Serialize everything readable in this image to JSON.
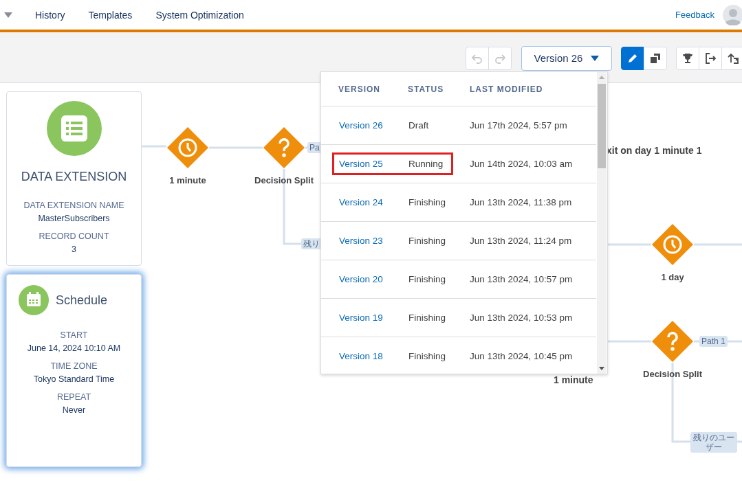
{
  "header": {
    "nav": [
      "History",
      "Templates",
      "System Optimization"
    ],
    "feedback": "Feedback"
  },
  "toolbar": {
    "undo_disabled": true,
    "redo_disabled": true,
    "version_button": "Version 26",
    "mode_buttons": [
      {
        "kind": "edit",
        "selected": true
      },
      {
        "kind": "copy",
        "selected": false
      }
    ],
    "action_buttons": [
      {
        "kind": "trophy"
      },
      {
        "kind": "exit"
      },
      {
        "kind": "swap"
      }
    ]
  },
  "version_menu": {
    "columns": [
      "VERSION",
      "STATUS",
      "LAST MODIFIED"
    ],
    "rows": [
      {
        "version": "Version 26",
        "status": "Draft",
        "last_modified": "Jun 17th 2024, 5:57 pm",
        "highlighted": false
      },
      {
        "version": "Version 25",
        "status": "Running",
        "last_modified": "Jun 14th 2024, 10:03 am",
        "highlighted": true
      },
      {
        "version": "Version 24",
        "status": "Finishing",
        "last_modified": "Jun 13th 2024, 11:38 pm",
        "highlighted": false
      },
      {
        "version": "Version 23",
        "status": "Finishing",
        "last_modified": "Jun 13th 2024, 11:24 pm",
        "highlighted": false
      },
      {
        "version": "Version 20",
        "status": "Finishing",
        "last_modified": "Jun 13th 2024, 10:57 pm",
        "highlighted": false
      },
      {
        "version": "Version 19",
        "status": "Finishing",
        "last_modified": "Jun 13th 2024, 10:53 pm",
        "highlighted": false
      },
      {
        "version": "Version 18",
        "status": "Finishing",
        "last_modified": "Jun 13th 2024, 10:45 pm",
        "highlighted": false
      }
    ]
  },
  "canvas": {
    "data_extension": {
      "title": "DATA EXTENSION",
      "fields": [
        {
          "label": "DATA EXTENSION NAME",
          "value": "MasterSubscribers"
        },
        {
          "label": "RECORD COUNT",
          "value": "3"
        }
      ]
    },
    "schedule": {
      "title": "Schedule",
      "fields": [
        {
          "label": "START",
          "value": "June 14, 2024 10:10 AM"
        },
        {
          "label": "TIME ZONE",
          "value": "Tokyo Standard Time"
        },
        {
          "label": "REPEAT",
          "value": "Never"
        }
      ]
    },
    "nodes": [
      {
        "kind": "wait",
        "label": "1 minute"
      },
      {
        "kind": "split",
        "label": "Decision Split"
      },
      {
        "kind": "wait",
        "label": "1 day"
      },
      {
        "kind": "split",
        "label": "Decision Split"
      }
    ],
    "path_labels": [
      "Pa",
      "残り",
      "Path 1",
      "残りのユーザー"
    ],
    "texts": [
      "xit on day 1 minute 1",
      "1 minute"
    ]
  }
}
